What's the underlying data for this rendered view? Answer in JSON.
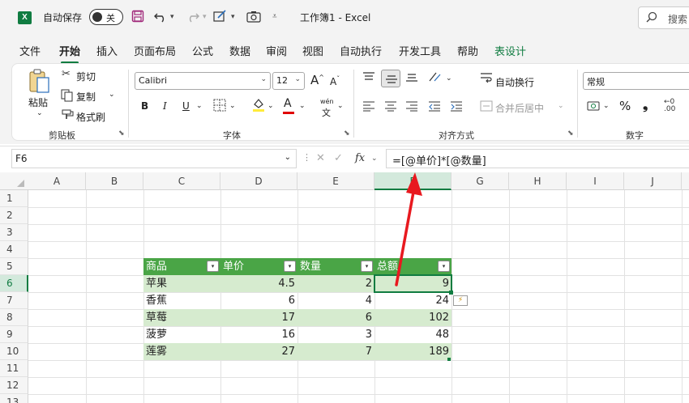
{
  "titlebar": {
    "logo": "X",
    "autosave_label": "自动保存",
    "autosave_state": "关",
    "icons": [
      "save-icon",
      "undo-icon",
      "redo-icon",
      "format-painter-icon",
      "camera-icon",
      "customize-icon"
    ],
    "doc_title": "工作簿1  -  Excel",
    "search_label": "搜索"
  },
  "menu": {
    "tabs": [
      "文件",
      "开始",
      "插入",
      "页面布局",
      "公式",
      "数据",
      "审阅",
      "视图",
      "自动执行",
      "开发工具",
      "帮助",
      "表设计"
    ],
    "active_index": 1
  },
  "ribbon": {
    "clipboard": {
      "paste": "粘贴",
      "cut": "剪切",
      "copy": "复制",
      "format_painter": "格式刷",
      "label": "剪贴板"
    },
    "font": {
      "font_name": "Calibri",
      "font_size": "12",
      "grow": "A",
      "shrink": "A",
      "bold": "B",
      "italic": "I",
      "underline": "U",
      "font_color_letter": "A",
      "wen": "wén",
      "label": "字体",
      "highlight_color": "#ffeb3b",
      "font_color": "#e00000"
    },
    "alignment": {
      "wrap_text": "自动换行",
      "merge_center": "合并后居中",
      "label": "对齐方式"
    },
    "number": {
      "format": "常规",
      "percent": "%",
      "comma": "❟",
      "label": "数字"
    }
  },
  "formula_bar": {
    "name_box": "F6",
    "cancel": "✕",
    "enter": "✓",
    "fx": "fx",
    "formula": "=[@单价]*[@数量]"
  },
  "grid": {
    "columns": [
      "A",
      "B",
      "C",
      "D",
      "E",
      "F",
      "G",
      "H",
      "I",
      "J"
    ],
    "selected_column": "F",
    "rows": [
      "1",
      "2",
      "3",
      "4",
      "5",
      "6",
      "7",
      "8",
      "9",
      "10",
      "11",
      "12",
      "13"
    ],
    "selected_row": "6",
    "filter_glyph": "▾",
    "table": {
      "headers": [
        "商品",
        "单价",
        "数量",
        "总额"
      ],
      "header_color": "#4aa546",
      "band_color": "#d6ebcf",
      "rows": [
        {
          "name": "苹果",
          "price": "4.5",
          "qty": "2",
          "total": "9"
        },
        {
          "name": "香蕉",
          "price": "6",
          "qty": "4",
          "total": "24"
        },
        {
          "name": "草莓",
          "price": "17",
          "qty": "6",
          "total": "102"
        },
        {
          "name": "菠萝",
          "price": "16",
          "qty": "3",
          "total": "48"
        },
        {
          "name": "莲雾",
          "price": "27",
          "qty": "7",
          "total": "189"
        }
      ]
    },
    "autofill_options_icon": "⚡"
  },
  "annotation": {
    "arrow_color": "#e8191f"
  }
}
